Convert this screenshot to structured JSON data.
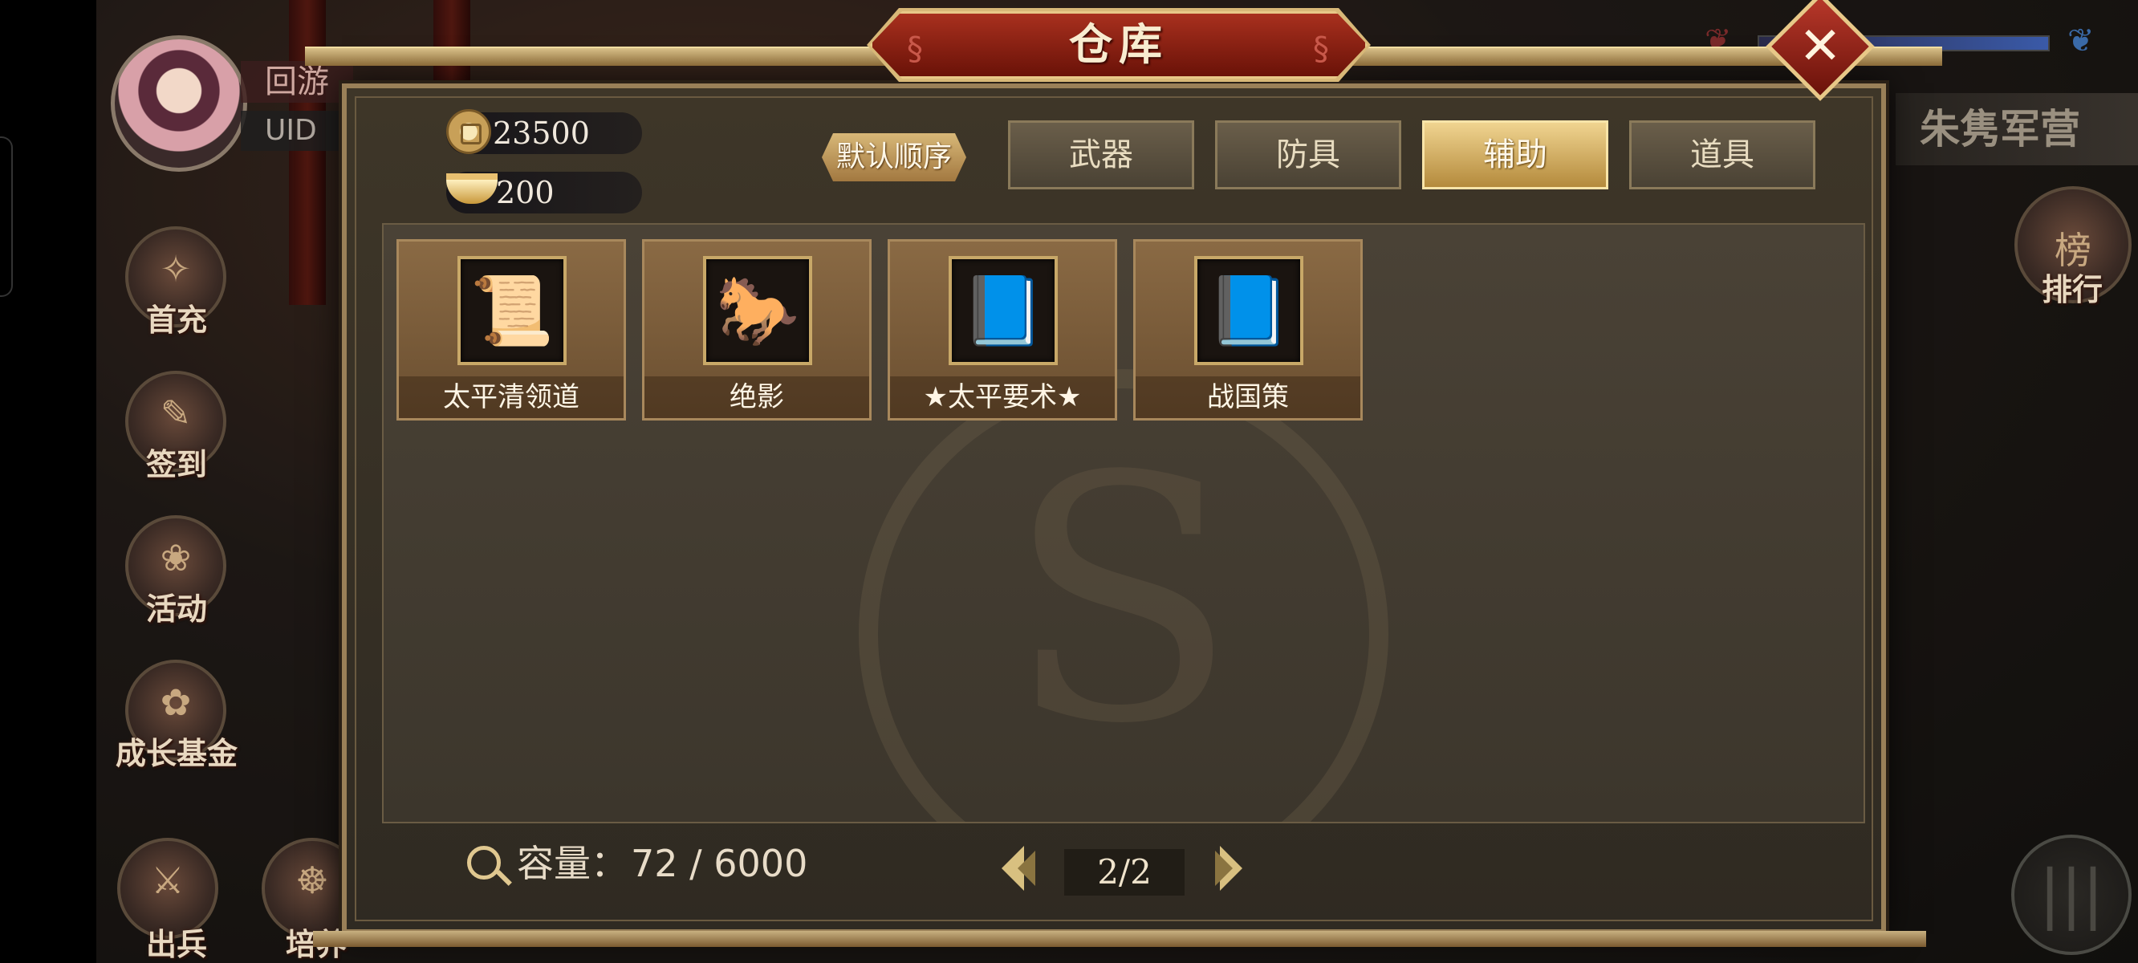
{
  "window": {
    "title": "仓库"
  },
  "player": {
    "name_partial": "回游",
    "uid_label": "UID"
  },
  "side_menu": [
    {
      "label": "首充",
      "icon": "gift-icon",
      "glyph": "✧"
    },
    {
      "label": "签到",
      "icon": "calendar-icon",
      "glyph": "✎"
    },
    {
      "label": "活动",
      "icon": "event-icon",
      "glyph": "❀"
    },
    {
      "label": "成长基金",
      "icon": "fund-icon",
      "glyph": "✿"
    }
  ],
  "bottom_menu": [
    {
      "label": "出兵",
      "icon": "troop-icon",
      "glyph": "⚔"
    },
    {
      "label": "培养",
      "icon": "train-icon",
      "glyph": "☸"
    }
  ],
  "right_panel": {
    "title": "朱隽军营",
    "rank_label": "排行",
    "rank_glyph": "榜"
  },
  "currency": {
    "coins": "23500",
    "ingots": "200"
  },
  "sort_label": "默认顺序",
  "tabs": [
    {
      "label": "武器",
      "active": false
    },
    {
      "label": "防具",
      "active": false
    },
    {
      "label": "辅助",
      "active": true
    },
    {
      "label": "道具",
      "active": false
    }
  ],
  "items": [
    {
      "name": "太平清领道",
      "icon": "scroll-icon",
      "glyph": "📜",
      "color": "#8a3ac8"
    },
    {
      "name": "绝影",
      "icon": "horse-icon",
      "glyph": "🐎",
      "color": "#4a6ab0"
    },
    {
      "name": "★太平要术★",
      "icon": "book-icon",
      "glyph": "📘",
      "color": "#2a60c0"
    },
    {
      "name": "战国策",
      "icon": "book-icon",
      "glyph": "📘",
      "color": "#2050b0"
    }
  ],
  "capacity": {
    "label": "容量：",
    "value": "72 / 6000"
  },
  "pager": {
    "current_total": "2/2"
  },
  "colors": {
    "accent_gold": "#d8b878",
    "banner_red": "#a8301e",
    "active_tab": "#f0d490"
  }
}
